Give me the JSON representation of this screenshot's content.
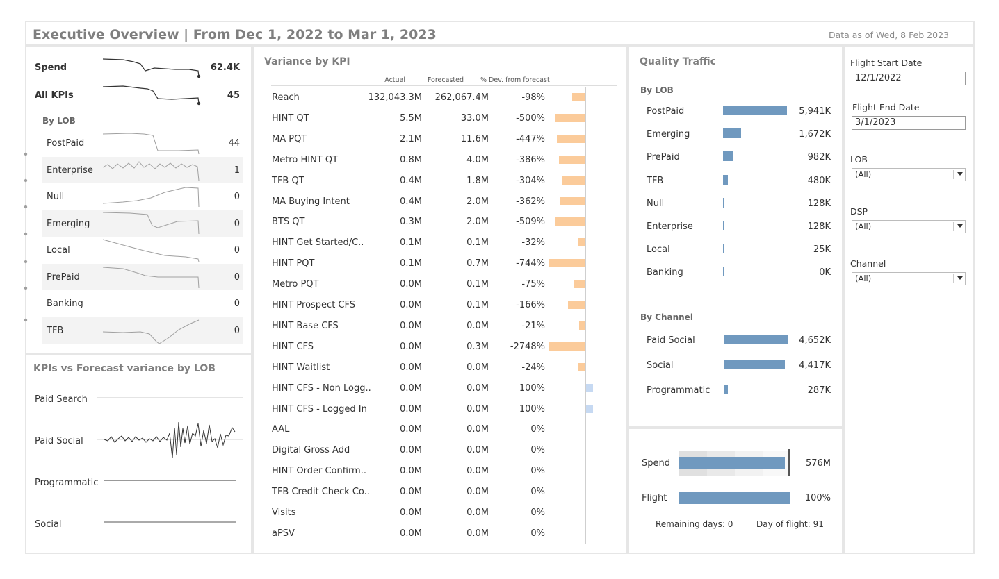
{
  "header": {
    "title": "Executive Overview | From Dec 1, 2022 to Mar 1, 2023",
    "data_as_of_label": "Data as of",
    "data_as_of_date": "Wed, 8 Feb 2023"
  },
  "kpi_panel": {
    "spend_label": "Spend",
    "spend_value": "62.4K",
    "all_kpis_label": "All KPIs",
    "all_kpis_value": "45",
    "by_lob_title": "By LOB",
    "lob_rows": [
      {
        "label": "PostPaid",
        "value": "44"
      },
      {
        "label": "Enterprise",
        "value": "1"
      },
      {
        "label": "Null",
        "value": "0"
      },
      {
        "label": "Emerging",
        "value": "0"
      },
      {
        "label": "Local",
        "value": "0"
      },
      {
        "label": "PrePaid",
        "value": "0"
      },
      {
        "label": "Banking",
        "value": "0"
      },
      {
        "label": "TFB",
        "value": "0"
      }
    ]
  },
  "forecast_panel": {
    "title": "KPIs vs Forecast variance by LOB",
    "rows": [
      {
        "label": "Paid Search"
      },
      {
        "label": "Paid Social"
      },
      {
        "label": "Programmatic"
      },
      {
        "label": "Social"
      }
    ]
  },
  "variance": {
    "title": "Variance by KPI",
    "col_actual": "Actual",
    "col_forecast": "Forecasted",
    "col_dev": "% Dev. from forecast",
    "rows": [
      {
        "kpi": "Reach",
        "actual": "132,043.3M",
        "forecast": "262,067.4M",
        "dev": "-98%",
        "dev_num": -98
      },
      {
        "kpi": "HINT QT",
        "actual": "5.5M",
        "forecast": "33.0M",
        "dev": "-500%",
        "dev_num": -500
      },
      {
        "kpi": "MA PQT",
        "actual": "2.1M",
        "forecast": "11.6M",
        "dev": "-447%",
        "dev_num": -447
      },
      {
        "kpi": "Metro HINT QT",
        "actual": "0.8M",
        "forecast": "4.0M",
        "dev": "-386%",
        "dev_num": -386
      },
      {
        "kpi": "TFB QT",
        "actual": "0.4M",
        "forecast": "1.8M",
        "dev": "-304%",
        "dev_num": -304
      },
      {
        "kpi": "MA Buying Intent",
        "actual": "0.4M",
        "forecast": "2.0M",
        "dev": "-362%",
        "dev_num": -362
      },
      {
        "kpi": "BTS QT",
        "actual": "0.3M",
        "forecast": "2.0M",
        "dev": "-509%",
        "dev_num": -509
      },
      {
        "kpi": "HINT Get Started/C..",
        "actual": "0.1M",
        "forecast": "0.1M",
        "dev": "-32%",
        "dev_num": -32
      },
      {
        "kpi": "HINT PQT",
        "actual": "0.1M",
        "forecast": "0.7M",
        "dev": "-744%",
        "dev_num": -744
      },
      {
        "kpi": "Metro PQT",
        "actual": "0.0M",
        "forecast": "0.1M",
        "dev": "-75%",
        "dev_num": -75
      },
      {
        "kpi": "HINT Prospect CFS",
        "actual": "0.0M",
        "forecast": "0.1M",
        "dev": "-166%",
        "dev_num": -166
      },
      {
        "kpi": "HINT Base CFS",
        "actual": "0.0M",
        "forecast": "0.0M",
        "dev": "-21%",
        "dev_num": -21
      },
      {
        "kpi": "HINT CFS",
        "actual": "0.0M",
        "forecast": "0.3M",
        "dev": "-2748%",
        "dev_num": -2748
      },
      {
        "kpi": "HINT Waitlist",
        "actual": "0.0M",
        "forecast": "0.0M",
        "dev": "-24%",
        "dev_num": -24
      },
      {
        "kpi": "HINT CFS - Non Logg..",
        "actual": "0.0M",
        "forecast": "0.0M",
        "dev": "100%",
        "dev_num": 100
      },
      {
        "kpi": "HINT CFS - Logged In",
        "actual": "0.0M",
        "forecast": "0.0M",
        "dev": "100%",
        "dev_num": 100
      },
      {
        "kpi": "AAL",
        "actual": "0.0M",
        "forecast": "0.0M",
        "dev": "0%",
        "dev_num": 0
      },
      {
        "kpi": "Digital Gross Add",
        "actual": "0.0M",
        "forecast": "0.0M",
        "dev": "0%",
        "dev_num": 0
      },
      {
        "kpi": "HINT Order Confirm..",
        "actual": "0.0M",
        "forecast": "0.0M",
        "dev": "0%",
        "dev_num": 0
      },
      {
        "kpi": "TFB Credit Check Co..",
        "actual": "0.0M",
        "forecast": "0.0M",
        "dev": "0%",
        "dev_num": 0
      },
      {
        "kpi": "Visits",
        "actual": "0.0M",
        "forecast": "0.0M",
        "dev": "0%",
        "dev_num": 0
      },
      {
        "kpi": "aPSV",
        "actual": "0.0M",
        "forecast": "0.0M",
        "dev": "0%",
        "dev_num": 0
      }
    ],
    "colors": {
      "negative": "#fbcb9a",
      "positive": "#c6d9f2"
    }
  },
  "quality": {
    "title": "Quality Traffic",
    "by_lob_title": "By LOB",
    "lob": [
      {
        "label": "PostPaid",
        "display": "5,941K",
        "value": 5941
      },
      {
        "label": "Emerging",
        "display": "1,672K",
        "value": 1672
      },
      {
        "label": "PrePaid",
        "display": "982K",
        "value": 982
      },
      {
        "label": "TFB",
        "display": "480K",
        "value": 480
      },
      {
        "label": "Null",
        "display": "128K",
        "value": 128
      },
      {
        "label": "Enterprise",
        "display": "128K",
        "value": 128
      },
      {
        "label": "Local",
        "display": "25K",
        "value": 25
      },
      {
        "label": "Banking",
        "display": "0K",
        "value": 0
      }
    ],
    "by_channel_title": "By Channel",
    "channel": [
      {
        "label": "Paid Social",
        "display": "4,652K",
        "value": 4652
      },
      {
        "label": "Social",
        "display": "4,417K",
        "value": 4417
      },
      {
        "label": "Programmatic",
        "display": "287K",
        "value": 287
      }
    ],
    "bar_color": "#7099bf"
  },
  "pacing": {
    "spend_label": "Spend",
    "spend_value": "576M",
    "spend_fraction": 0.95,
    "flight_label": "Flight",
    "flight_value": "100%",
    "flight_fraction": 1.0,
    "remaining_label": "Remaining days:",
    "remaining_value": "0",
    "day_label": "Day of flight:",
    "day_value": "91"
  },
  "filters": {
    "start_label": "Flight Start Date",
    "start_value": "12/1/2022",
    "end_label": "Flight End Date",
    "end_value": "3/1/2023",
    "lob_label": "LOB",
    "lob_value": "(All)",
    "dsp_label": "DSP",
    "dsp_value": "(All)",
    "channel_label": "Channel",
    "channel_value": "(All)"
  }
}
